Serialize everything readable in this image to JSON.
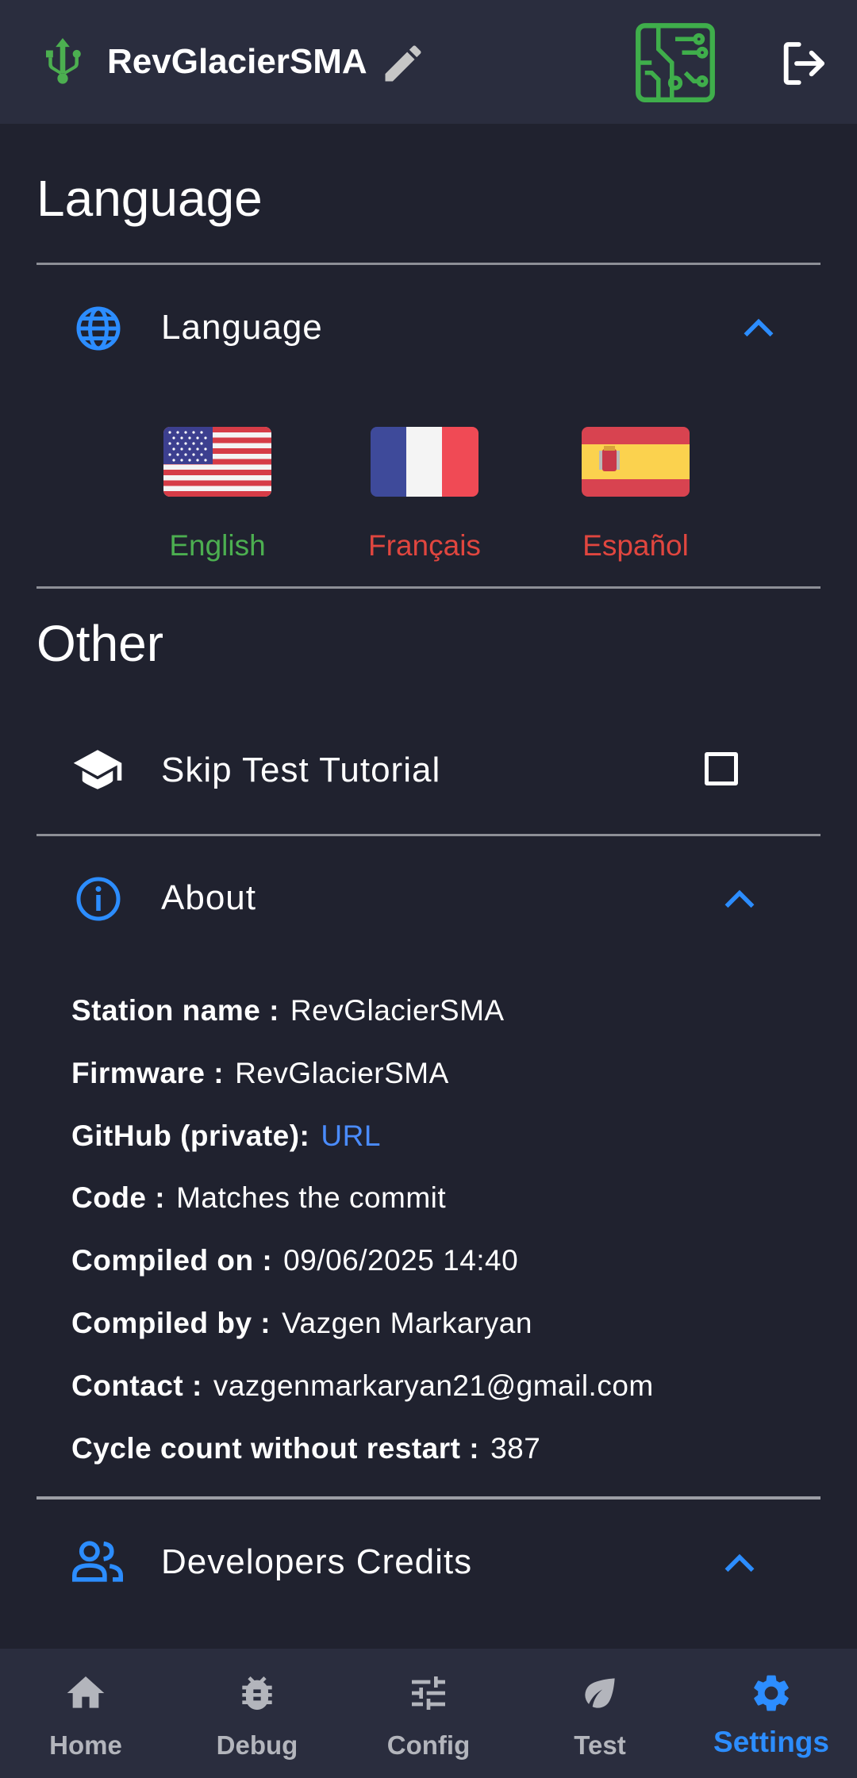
{
  "header": {
    "station_title": "RevGlacierSMA",
    "icons": {
      "connection": "usb-icon",
      "edit": "pencil-icon",
      "board": "circuit-board-icon",
      "logout": "logout-icon"
    }
  },
  "language_section": {
    "title": "Language",
    "panel_label": "Language",
    "options": [
      {
        "label": "English",
        "color": "#4caf50",
        "flag": "us-flag"
      },
      {
        "label": "Français",
        "color": "#e0463f",
        "flag": "france-flag"
      },
      {
        "label": "Español",
        "color": "#e0463f",
        "flag": "spain-flag"
      }
    ]
  },
  "other_section": {
    "title": "Other",
    "skip_tutorial_label": "Skip Test Tutorial",
    "skip_tutorial_checked": false,
    "about_label": "About",
    "about": [
      {
        "key": "Station name :",
        "value": "RevGlacierSMA"
      },
      {
        "key": "Firmware :",
        "value": "RevGlacierSMA"
      },
      {
        "key": "GitHub (private):",
        "value": "URL"
      },
      {
        "key": "Code :",
        "value": "Matches the commit"
      },
      {
        "key": "Compiled on :",
        "value": "09/06/2025 14:40"
      },
      {
        "key": "Compiled by :",
        "value": "Vazgen Markaryan"
      },
      {
        "key": "Contact :",
        "value": "vazgenmarkaryan21@gmail.com"
      },
      {
        "key": "Cycle count without restart :",
        "value": "387"
      }
    ],
    "credits_label": "Developers Credits"
  },
  "bottom_nav": [
    {
      "label": "Home",
      "icon": "home-icon"
    },
    {
      "label": "Debug",
      "icon": "bug-icon"
    },
    {
      "label": "Config",
      "icon": "sliders-icon"
    },
    {
      "label": "Test",
      "icon": "leaf-icon"
    },
    {
      "label": "Settings",
      "icon": "gear-icon",
      "active": true
    }
  ],
  "colors": {
    "accent": "#2c8dff",
    "background": "#20222f",
    "bar": "#2a2d3e",
    "green": "#4caf50"
  }
}
